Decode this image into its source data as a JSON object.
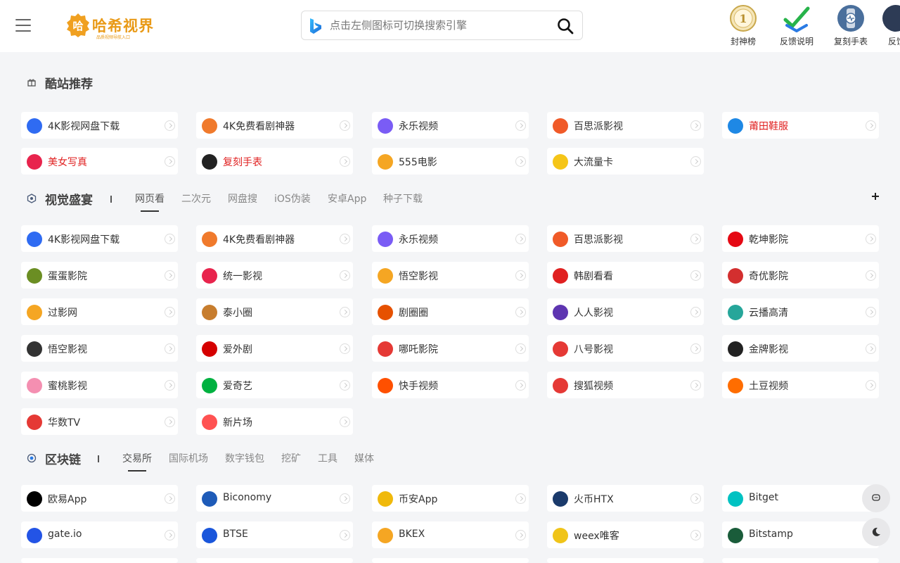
{
  "header": {
    "logo_text": "哈希视界",
    "logo_subtext": "品质视频导航入口",
    "search_placeholder": "点击左侧图标可切换搜索引擎",
    "top_items": [
      {
        "label": "封神榜",
        "icon": "medal-icon"
      },
      {
        "label": "反馈说明",
        "icon": "check-icon"
      },
      {
        "label": "复刻手表",
        "icon": "watch-icon"
      },
      {
        "label": "反馈",
        "icon": "feedback-icon"
      }
    ]
  },
  "sections": {
    "recommend": {
      "title": "酷站推荐",
      "cards": [
        {
          "label": "4K影视网盘下载",
          "color": "#2f6bf2"
        },
        {
          "label": "4K免费看剧神器",
          "color": "#f07a2c"
        },
        {
          "label": "永乐视频",
          "color": "#7a5cf5"
        },
        {
          "label": "百思派影视",
          "color": "#f05a28"
        },
        {
          "label": "莆田鞋服",
          "color": "#1e88e5",
          "red": true
        },
        {
          "label": "美女写真",
          "color": "#e8244d",
          "red": true
        },
        {
          "label": "复刻手表",
          "color": "#222222",
          "red": true
        },
        {
          "label": "555电影",
          "color": "#f5a623"
        },
        {
          "label": "大流量卡",
          "color": "#f5c518"
        }
      ]
    },
    "visual": {
      "title": "视觉盛宴",
      "tabs": [
        "网页看",
        "二次元",
        "网盘搜",
        "iOS伪装",
        "安卓App",
        "种子下载"
      ],
      "active_tab": "网页看",
      "cards": [
        {
          "label": "4K影视网盘下载",
          "color": "#2f6bf2"
        },
        {
          "label": "4K免费看剧神器",
          "color": "#f07a2c"
        },
        {
          "label": "永乐视频",
          "color": "#7a5cf5"
        },
        {
          "label": "百思派影视",
          "color": "#f05a28"
        },
        {
          "label": "乾坤影院",
          "color": "#e50914"
        },
        {
          "label": "蛋蛋影院",
          "color": "#6b8e23"
        },
        {
          "label": "统一影视",
          "color": "#e8244d"
        },
        {
          "label": "悟空影视",
          "color": "#f5a623"
        },
        {
          "label": "韩剧看看",
          "color": "#e02020"
        },
        {
          "label": "奇优影院",
          "color": "#d32f2f"
        },
        {
          "label": "过影网",
          "color": "#f5a623"
        },
        {
          "label": "泰小圈",
          "color": "#c77d2e"
        },
        {
          "label": "剧圈圈",
          "color": "#e65100"
        },
        {
          "label": "人人影视",
          "color": "#5e35b1"
        },
        {
          "label": "云播高清",
          "color": "#26a69a"
        },
        {
          "label": "悟空影视",
          "color": "#333333"
        },
        {
          "label": "爱外剧",
          "color": "#d50000"
        },
        {
          "label": "哪吒影院",
          "color": "#e53935"
        },
        {
          "label": "八号影视",
          "color": "#e53935"
        },
        {
          "label": "金牌影视",
          "color": "#222222"
        },
        {
          "label": "蜜桃影视",
          "color": "#f48fb1"
        },
        {
          "label": "爱奇艺",
          "color": "#00b140"
        },
        {
          "label": "快手视频",
          "color": "#ff5000"
        },
        {
          "label": "搜狐视频",
          "color": "#e53935"
        },
        {
          "label": "土豆视频",
          "color": "#ff6d00"
        },
        {
          "label": "华数TV",
          "color": "#e53935"
        },
        {
          "label": "新片场",
          "color": "#ff5252"
        }
      ]
    },
    "blockchain": {
      "title": "区块链",
      "tabs": [
        "交易所",
        "国际机场",
        "数字钱包",
        "挖矿",
        "工具",
        "媒体"
      ],
      "active_tab": "交易所",
      "cards": [
        {
          "label": "欧易App",
          "color": "#000000"
        },
        {
          "label": "Biconomy",
          "color": "#1e5bb8"
        },
        {
          "label": "币安App",
          "color": "#f0b90b"
        },
        {
          "label": "火币HTX",
          "color": "#1a3a6b"
        },
        {
          "label": "Bitget",
          "color": "#00c2c2"
        },
        {
          "label": "gate.io",
          "color": "#2354e6"
        },
        {
          "label": "BTSE",
          "color": "#1a56db"
        },
        {
          "label": "BKEX",
          "color": "#f5a623"
        },
        {
          "label": "weex唯客",
          "color": "#f0c419"
        },
        {
          "label": "Bitstamp",
          "color": "#1a5c3a"
        }
      ]
    }
  }
}
